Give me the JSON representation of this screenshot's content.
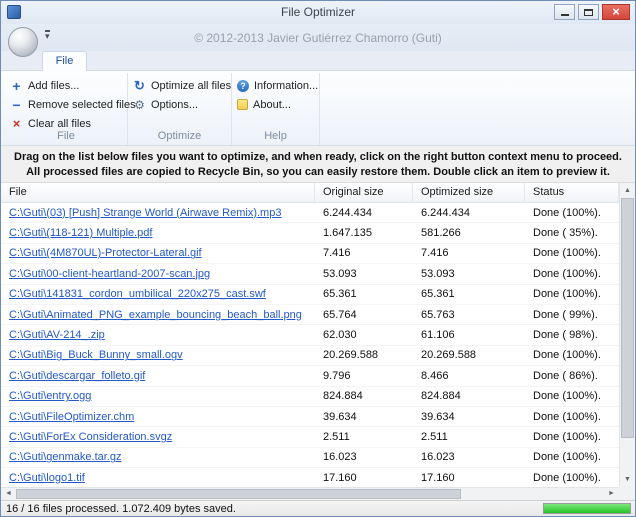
{
  "window": {
    "title": "File Optimizer",
    "copyright": "© 2012-2013 Javier Gutiérrez Chamorro (Guti)"
  },
  "icons": {
    "add_files": "+",
    "remove_files": "−",
    "clear_files": "×",
    "optimize": "↻",
    "options": "⚙",
    "information": "?",
    "close": "×",
    "qat_dropdown": "▾",
    "scroll_up": "▲",
    "scroll_down": "▼",
    "scroll_left": "◄",
    "scroll_right": "►"
  },
  "ribbon": {
    "tab_label": "File",
    "groups": [
      {
        "caption": "File",
        "buttons": [
          {
            "label": "Add files..."
          },
          {
            "label": "Remove selected files"
          },
          {
            "label": "Clear all files"
          }
        ]
      },
      {
        "caption": "Optimize",
        "buttons": [
          {
            "label": "Optimize all files"
          },
          {
            "label": "Options..."
          }
        ]
      },
      {
        "caption": "Help",
        "buttons": [
          {
            "label": "Information..."
          },
          {
            "label": "About..."
          }
        ]
      }
    ]
  },
  "instructions": "Drag on the list below files you want to optimize, and when ready, click on the right button context menu to proceed. All processed files are copied to Recycle Bin, so you can easily restore them. Double click an item to preview it.",
  "table": {
    "columns": [
      "File",
      "Original size",
      "Optimized size",
      "Status"
    ],
    "rows": [
      {
        "file": "C:\\Guti\\(03) [Push] Strange World (Airwave Remix).mp3",
        "original": "6.244.434",
        "optimized": "6.244.434",
        "status": "Done (100%)."
      },
      {
        "file": "C:\\Guti\\(118-121) Multiple.pdf",
        "original": "1.647.135",
        "optimized": "581.266",
        "status": "Done ( 35%)."
      },
      {
        "file": "C:\\Guti\\(4M870UL)-Protector-Lateral.gif",
        "original": "7.416",
        "optimized": "7.416",
        "status": "Done (100%)."
      },
      {
        "file": "C:\\Guti\\00-client-heartland-2007-scan.jpg",
        "original": "53.093",
        "optimized": "53.093",
        "status": "Done (100%)."
      },
      {
        "file": "C:\\Guti\\141831_cordon_umbilical_220x275_cast.swf",
        "original": "65.361",
        "optimized": "65.361",
        "status": "Done (100%)."
      },
      {
        "file": "C:\\Guti\\Animated_PNG_example_bouncing_beach_ball.png",
        "original": "65.764",
        "optimized": "65.763",
        "status": "Done ( 99%)."
      },
      {
        "file": "C:\\Guti\\AV-214_.zip",
        "original": "62.030",
        "optimized": "61.106",
        "status": "Done ( 98%)."
      },
      {
        "file": "C:\\Guti\\Big_Buck_Bunny_small.ogv",
        "original": "20.269.588",
        "optimized": "20.269.588",
        "status": "Done (100%)."
      },
      {
        "file": "C:\\Guti\\descargar_folleto.gif",
        "original": "9.796",
        "optimized": "8.466",
        "status": "Done ( 86%)."
      },
      {
        "file": "C:\\Guti\\entry.ogg",
        "original": "824.884",
        "optimized": "824.884",
        "status": "Done (100%)."
      },
      {
        "file": "C:\\Guti\\FileOptimizer.chm",
        "original": "39.634",
        "optimized": "39.634",
        "status": "Done (100%)."
      },
      {
        "file": "C:\\Guti\\ForEx Consideration.svgz",
        "original": "2.511",
        "optimized": "2.511",
        "status": "Done (100%)."
      },
      {
        "file": "C:\\Guti\\genmake.tar.gz",
        "original": "16.023",
        "optimized": "16.023",
        "status": "Done (100%)."
      },
      {
        "file": "C:\\Guti\\logo1.tif",
        "original": "17.160",
        "optimized": "17.160",
        "status": "Done (100%)."
      }
    ]
  },
  "statusbar": {
    "text": "16 / 16 files processed. 1.072.409 bytes saved.",
    "progress_percent": 100
  }
}
